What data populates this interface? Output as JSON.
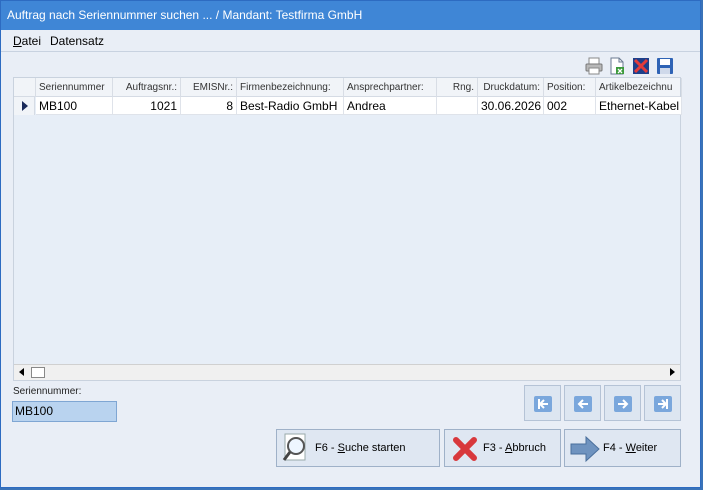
{
  "window": {
    "title": "Auftrag nach Seriennummer suchen ... / Mandant: Testfirma GmbH"
  },
  "menu": {
    "items": [
      {
        "key": "D",
        "rest": "atei"
      },
      {
        "key": "",
        "rest": "Datensatz"
      }
    ]
  },
  "toolbar": {
    "icons": [
      "printer-icon",
      "export-icon",
      "delete-icon",
      "save-icon"
    ]
  },
  "grid": {
    "columns": [
      "Seriennummer",
      "Auftragsnr.:",
      "EMISNr.:",
      "Firmenbezeichnung:",
      "Ansprechpartner:",
      "Rng.",
      "Druckdatum:",
      "Position:",
      "Artikelbezeichnu"
    ],
    "rows": [
      {
        "seriennummer": "MB100",
        "auftragsnr": "1021",
        "emisnr": "8",
        "firma": "Best-Radio GmbH",
        "ansprechpartner": "Andrea",
        "rng": "",
        "druckdatum": "30.06.2026",
        "position": "002",
        "artikel": "Ethernet-Kabel"
      }
    ]
  },
  "search": {
    "label": "Seriennummer:",
    "value": "MB100"
  },
  "navigation": {
    "buttons": [
      "first-record",
      "previous-record",
      "next-record",
      "last-record"
    ]
  },
  "actions": {
    "search": {
      "prefix": "F6 - ",
      "key": "S",
      "rest": "uche starten"
    },
    "cancel": {
      "prefix": "F3 - ",
      "key": "A",
      "rest": "bbruch"
    },
    "next": {
      "prefix": "F4 - ",
      "key": "W",
      "rest": "eiter"
    }
  },
  "colors": {
    "titlebar": "#3f86d6",
    "window_bg": "#e9eef6",
    "grid_bg": "#e7eef7",
    "input_bg": "#b9d3ef",
    "nav_icon": "#7aa7dc",
    "cancel_red": "#d8383c"
  }
}
